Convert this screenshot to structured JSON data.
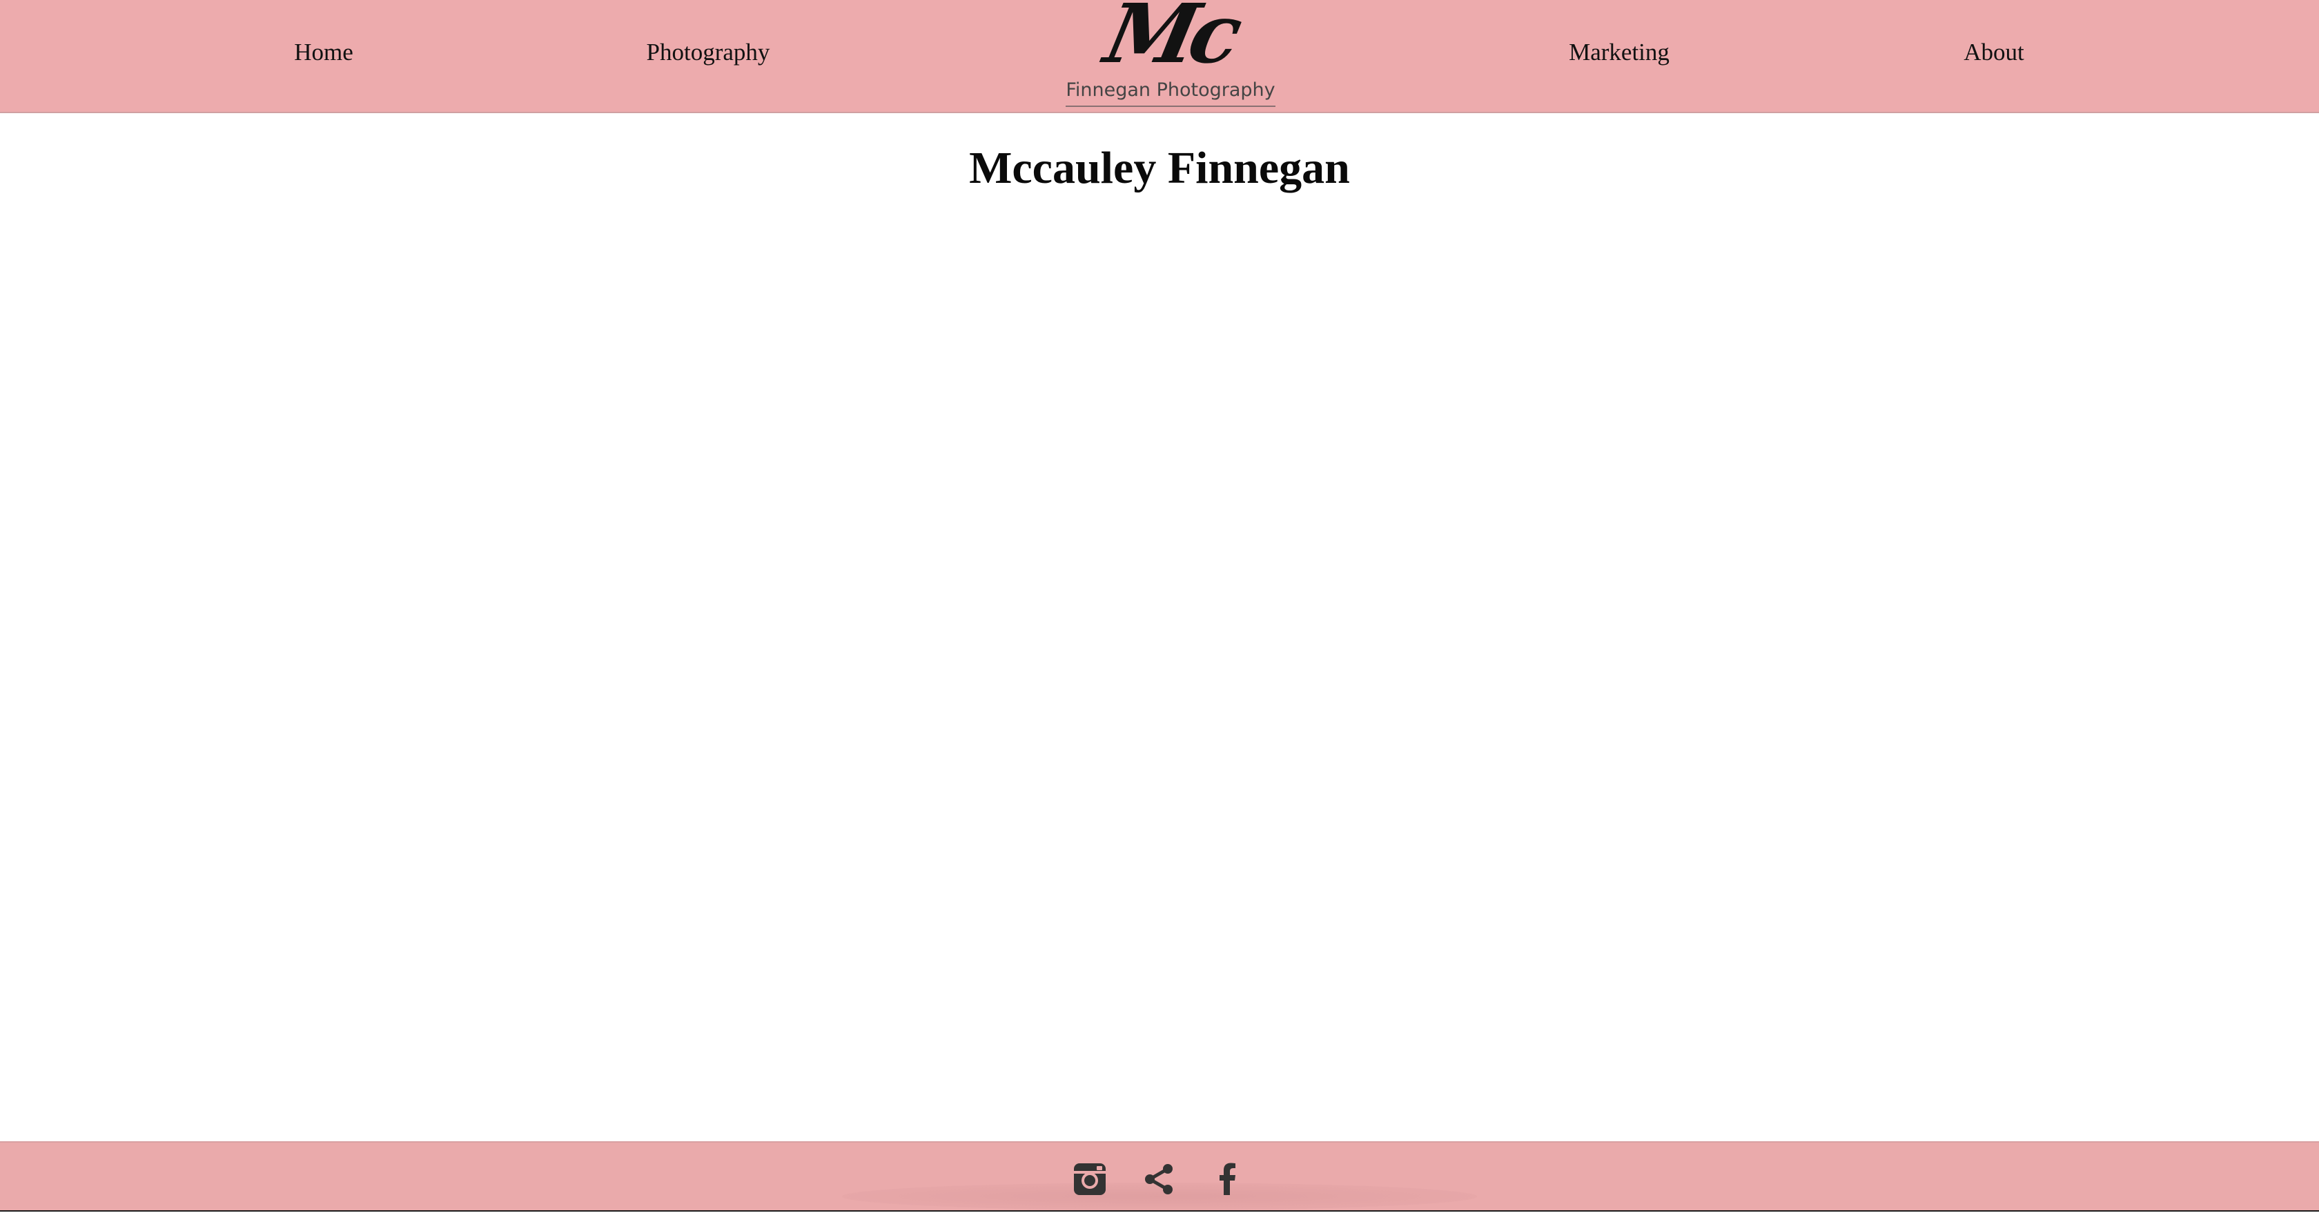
{
  "nav": {
    "items": [
      {
        "label": "Home"
      },
      {
        "label": "Photography"
      },
      {
        "label": "Marketing"
      },
      {
        "label": "About"
      }
    ]
  },
  "logo": {
    "monogram": "Mc",
    "subtitle": "Finnegan Photography"
  },
  "main": {
    "title": "Mccauley Finnegan"
  },
  "footer": {
    "icons": [
      "instagram-icon",
      "share-icon",
      "facebook-icon"
    ]
  },
  "colors": {
    "header_bg": "#edabad",
    "footer_bg": "#eaaaab",
    "page_bg": "#ffffff",
    "text": "#111111",
    "icon": "#333333"
  }
}
